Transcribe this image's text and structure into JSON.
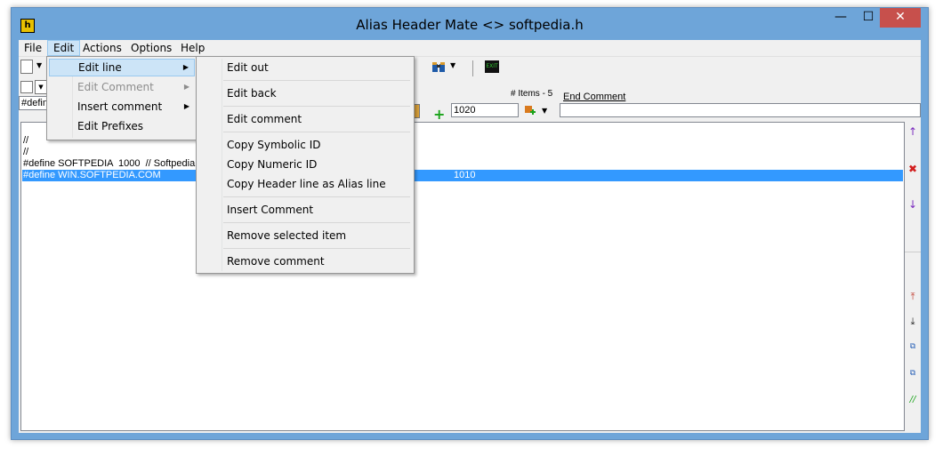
{
  "window": {
    "title": "Alias Header Mate <> softpedia.h",
    "app_icon_label": "h",
    "minimize": "—",
    "maximize": "☐",
    "close": "✕"
  },
  "menubar": {
    "items": [
      "File",
      "Edit",
      "Actions",
      "Options",
      "Help"
    ]
  },
  "toolbar": {
    "items_label": "# Items - 5",
    "end_comment_label": "End Comment",
    "numeric_value": "1020",
    "define_value": "#defin",
    "end_comment_value": ""
  },
  "list": {
    "rows": [
      "//",
      "//",
      "#define SOFTPEDIA  1000  // Softpedia",
      "#define WIN.SOFTPEDIA.COM"
    ],
    "selected_value": "1010"
  },
  "edit_menu": {
    "items": [
      {
        "label": "Edit line",
        "submenu": true,
        "highlighted": true,
        "disabled": false
      },
      {
        "label": "Edit Comment",
        "submenu": true,
        "highlighted": false,
        "disabled": true
      },
      {
        "label": "Insert comment",
        "submenu": true,
        "highlighted": false,
        "disabled": false
      },
      {
        "label": "Edit Prefixes",
        "submenu": false,
        "highlighted": false,
        "disabled": false
      }
    ]
  },
  "edit_line_submenu": {
    "items": [
      "Edit out",
      "Edit back",
      "Edit comment",
      "Copy Symbolic ID",
      "Copy Numeric ID",
      "Copy Header line as Alias line",
      "Insert Comment",
      "Remove selected item",
      "Remove comment"
    ]
  },
  "colors": {
    "titlebar": "#6ea5d9",
    "selection": "#3399ff",
    "menu_highlight": "#cce4f7",
    "close_button": "#c7504c"
  }
}
